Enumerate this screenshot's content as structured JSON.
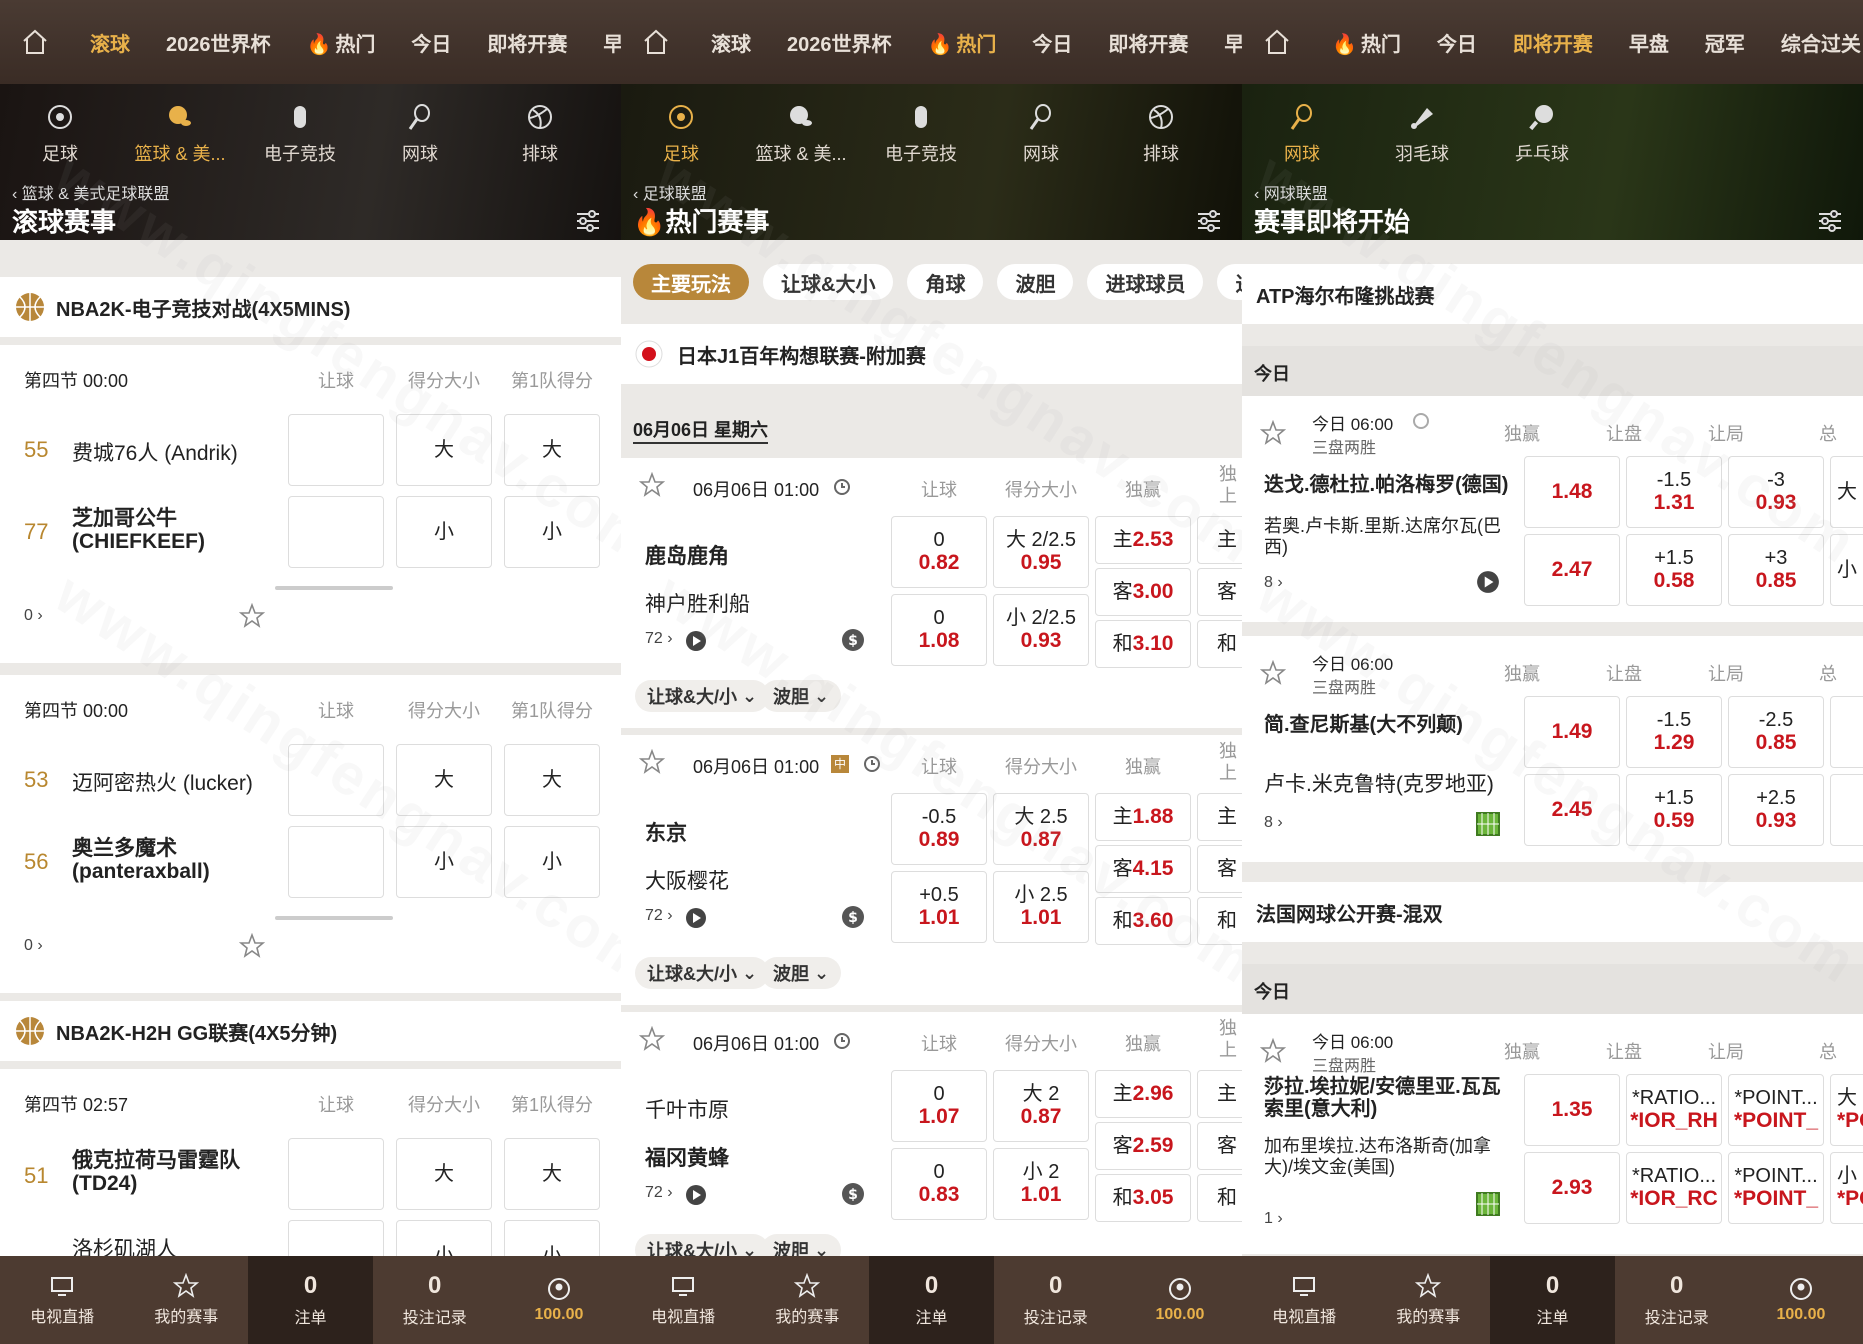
{
  "colors": {
    "accent": "#e8b14a",
    "odds": "#c8161d",
    "score": "#b8872f",
    "tabActive": "#b8873a"
  },
  "watermark": "www.qingfengnav.com",
  "p1": {
    "nav": [
      "滚球",
      "2026世界杯",
      "热门",
      "今日",
      "即将开赛",
      "早"
    ],
    "sports": [
      "足球",
      "篮球 & 美...",
      "电子竞技",
      "网球",
      "排球"
    ],
    "crumb": "篮球 & 美式足球联盟",
    "title": "滚球赛事",
    "league1": "NBA2K-电子竞技对战(4X5MINS)",
    "league2": "NBA2K-H2H GG联赛(4X5分钟)",
    "hdr": [
      "让球",
      "得分大小",
      "第1队得分"
    ],
    "m1": {
      "time": "第四节 00:00",
      "s1": "55",
      "t1": "费城76人 (Andrik)",
      "s2": "77",
      "t2": "芝加哥公牛 (CHIEFKEEF)",
      "o1": "大",
      "o2": "小",
      "o3": "大",
      "o4": "小",
      "count": "0"
    },
    "m2": {
      "time": "第四节 00:00",
      "s1": "53",
      "t1": "迈阿密热火 (lucker)",
      "s2": "56",
      "t2": "奥兰多魔术 (panteraxball)",
      "o1": "大",
      "o2": "小",
      "o3": "大",
      "o4": "小",
      "count": "0"
    },
    "m3": {
      "time": "第四节 02:57",
      "s1": "51",
      "t1": "俄克拉荷马雷霆队 (TD24)",
      "t2": "洛杉矶湖人",
      "o1": "大",
      "o2": "小",
      "o3": "大",
      "o4": "小"
    }
  },
  "p2": {
    "nav": [
      "滚球",
      "2026世界杯",
      "热门",
      "今日",
      "即将开赛",
      "早"
    ],
    "sports": [
      "足球",
      "篮球 & 美...",
      "电子竞技",
      "网球",
      "排球"
    ],
    "crumb": "足球联盟",
    "title": "热门赛事",
    "tabs": [
      "主要玩法",
      "让球&大小",
      "角球",
      "波胆",
      "进球球员",
      "进"
    ],
    "league": "日本J1百年构想联赛-附加赛",
    "date": "06月06日 星期六",
    "hdr": [
      "让球",
      "得分大小",
      "独赢",
      "独上"
    ],
    "chips": [
      "让球&大/小",
      "波胆"
    ],
    "matches": [
      {
        "time": "06月06日 01:00",
        "t1": "鹿岛鹿角",
        "t2": "神户胜利船",
        "h1": "0",
        "h1o": "0.82",
        "h2": "0",
        "h2o": "1.08",
        "g1": "大 2/2.5",
        "g1o": "0.95",
        "g2": "小 2/2.5",
        "g2o": "0.93",
        "w1": "主",
        "w1o": "2.53",
        "w2": "客",
        "w2o": "3.00",
        "w3": "和",
        "w3o": "3.10",
        "count": "72"
      },
      {
        "time": "06月06日 01:00",
        "t1": "东京",
        "t2": "大阪樱花",
        "h1": "-0.5",
        "h1o": "0.89",
        "h2": "+0.5",
        "h2o": "1.01",
        "g1": "大 2.5",
        "g1o": "0.87",
        "g2": "小 2.5",
        "g2o": "1.01",
        "w1": "主",
        "w1o": "1.88",
        "w2": "客",
        "w2o": "4.15",
        "w3": "和",
        "w3o": "3.60",
        "count": "72"
      },
      {
        "time": "06月06日 01:00",
        "t1": "千叶市原",
        "t2": "福冈黄蜂",
        "h1": "0",
        "h1o": "1.07",
        "h2": "0",
        "h2o": "0.83",
        "g1": "大 2",
        "g1o": "0.87",
        "g2": "小 2",
        "g2o": "1.01",
        "w1": "主",
        "w1o": "2.96",
        "w2": "客",
        "w2o": "2.59",
        "w3": "和",
        "w3o": "3.05",
        "count": "72"
      }
    ]
  },
  "p3": {
    "nav": [
      "热门",
      "今日",
      "即将开赛",
      "早盘",
      "冠军",
      "综合过关"
    ],
    "sports": [
      "网球",
      "羽毛球",
      "乒乓球"
    ],
    "crumb": "网球联盟",
    "title": "赛事即将开始",
    "league1": "ATP海尔布隆挑战赛",
    "league2": "法国网球公开赛-混双",
    "today": "今日",
    "hdr": [
      "独赢",
      "让盘",
      "让局",
      "总"
    ],
    "matches": [
      {
        "time": "今日 06:00",
        "fmt": "三盘两胜",
        "t1": "迭戈.德杜拉.帕洛梅罗(德国)",
        "t2": "若奥.卢卡斯.里斯.达席尔瓦(巴西)",
        "w1": "1.48",
        "w2": "2.47",
        "a1": "-1.5",
        "a1o": "1.31",
        "a2": "+1.5",
        "a2o": "0.58",
        "b1": "-3",
        "b1o": "0.93",
        "b2": "+3",
        "b2o": "0.85",
        "c1": "大",
        "c2": "小",
        "count": "8"
      },
      {
        "time": "今日 06:00",
        "fmt": "三盘两胜",
        "t1": "简.查尼斯基(大不列颠)",
        "t2": "卢卡.米克鲁特(克罗地亚)",
        "w1": "1.49",
        "w2": "2.45",
        "a1": "-1.5",
        "a1o": "1.29",
        "a2": "+1.5",
        "a2o": "0.59",
        "b1": "-2.5",
        "b1o": "0.85",
        "b2": "+2.5",
        "b2o": "0.93",
        "c1": "",
        "c2": "",
        "count": "8"
      },
      {
        "time": "今日 06:00",
        "fmt": "三盘两胜",
        "t1": "莎拉.埃拉妮/安德里亚.瓦瓦索里(意大利)",
        "t2": "加布里埃拉.达布洛斯奇(加拿大)/埃文金(美国)",
        "w1": "1.35",
        "w2": "2.93",
        "a1": "*RATIO...",
        "a1o": "*IOR_RH",
        "a2": "*RATIO...",
        "a2o": "*IOR_RC",
        "b1": "*POINT...",
        "b1o": "*POINT_",
        "b2": "*POINT...",
        "b2o": "*POINT_",
        "c1": "大",
        "c1o": "*PC",
        "c2": "小",
        "c2o": "*PC",
        "count": "1"
      }
    ]
  },
  "bottom": {
    "tv": "电视直播",
    "fav": "我的赛事",
    "slip_num": "0",
    "slip": "注单",
    "rec_num": "0",
    "rec": "投注记录",
    "bal": "100.00"
  }
}
